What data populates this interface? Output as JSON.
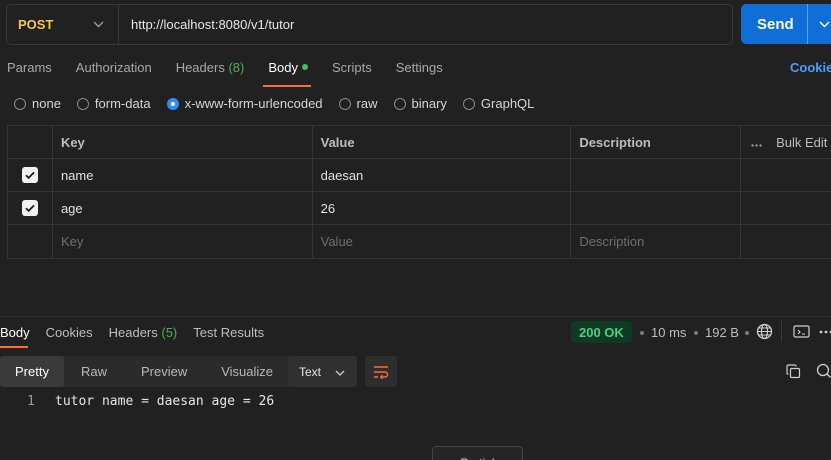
{
  "request": {
    "method": "POST",
    "url": "http://localhost:8080/v1/tutor",
    "send_label": "Send"
  },
  "req_tabs": [
    {
      "label": "Params"
    },
    {
      "label": "Authorization"
    },
    {
      "label": "Headers",
      "count": "(8)"
    },
    {
      "label": "Body"
    },
    {
      "label": "Scripts"
    },
    {
      "label": "Settings"
    }
  ],
  "cookies_label": "Cookie",
  "body_types": [
    "none",
    "form-data",
    "x-www-form-urlencoded",
    "raw",
    "binary",
    "GraphQL"
  ],
  "selected_body_type": "x-www-form-urlencoded",
  "table": {
    "headers": {
      "key": "Key",
      "value": "Value",
      "description": "Description",
      "bulk": "Bulk Edit"
    },
    "rows": [
      {
        "key": "name",
        "value": "daesan",
        "description": ""
      },
      {
        "key": "age",
        "value": "26",
        "description": ""
      }
    ],
    "placeholders": {
      "key": "Key",
      "value": "Value",
      "description": "Description"
    }
  },
  "response": {
    "tabs": [
      {
        "label": "Body"
      },
      {
        "label": "Cookies"
      },
      {
        "label": "Headers",
        "count": "(5)"
      },
      {
        "label": "Test Results"
      }
    ],
    "status": "200 OK",
    "time": "10 ms",
    "size": "192 B",
    "view_tabs": [
      "Pretty",
      "Raw",
      "Preview",
      "Visualize"
    ],
    "format": "Text",
    "line_number": "1",
    "code": "tutor name = daesan age = 26",
    "partial_button": "Partial"
  },
  "colors": {
    "accent": "#ff6c37",
    "primary": "#0f6fd6",
    "method": "#f2c94c",
    "status_ok": "#4bd07f"
  }
}
